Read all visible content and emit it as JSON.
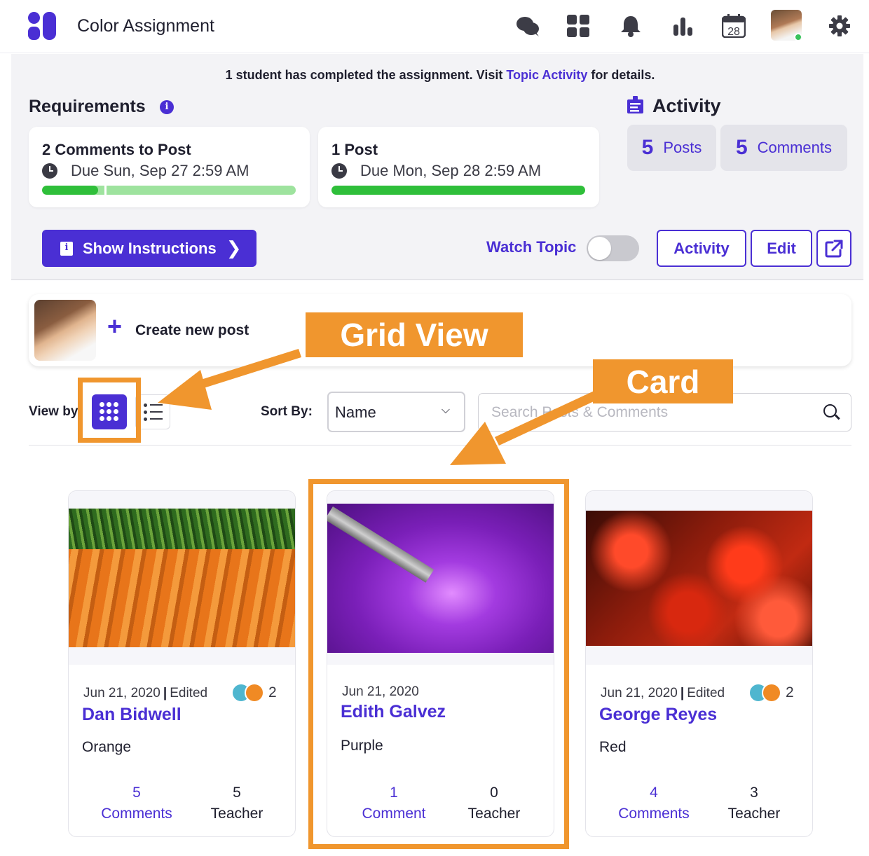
{
  "app": {
    "title": "Color Assignment"
  },
  "header_icons": [
    "chat-bubbles-icon",
    "apps-grid-icon",
    "bell-icon",
    "bar-chart-icon",
    "calendar-icon",
    "avatar",
    "gear-icon"
  ],
  "calendar_day": "28",
  "notice": {
    "before": "1 student has completed the assignment. Visit ",
    "link": "Topic Activity",
    "after": " for details."
  },
  "requirements": {
    "title": "Requirements",
    "info_glyph": "i",
    "items": [
      {
        "title": "2 Comments to Post",
        "due": "Due Sun, Sep 27 2:59 AM",
        "progress": 0.22
      },
      {
        "title": "1 Post",
        "due": "Due Mon, Sep 28 2:59 AM",
        "progress": 1.0
      }
    ]
  },
  "activity": {
    "title": "Activity",
    "posts_count": "5",
    "posts_label": "Posts",
    "comments_count": "5",
    "comments_label": "Comments"
  },
  "actions": {
    "show_instructions": "Show Instructions",
    "watch_topic": "Watch Topic",
    "watch_on": false,
    "activity": "Activity",
    "edit": "Edit"
  },
  "create_post": {
    "label": "Create new post"
  },
  "toolbar": {
    "view_by": "View by",
    "sort_by": "Sort By:",
    "sort_value": "Name",
    "search_placeholder": "Search Posts & Comments"
  },
  "annotations": {
    "grid_view": "Grid View",
    "card": "Card"
  },
  "posts": [
    {
      "date": "Jun 21, 2020",
      "edited": "Edited",
      "reactions": "2",
      "author": "Dan Bidwell",
      "text": "Orange",
      "comments_count": "5",
      "comments_label": "Comments",
      "teacher_count": "5",
      "teacher_label": "Teacher",
      "image": "carrots"
    },
    {
      "date": "Jun 21, 2020",
      "edited": "",
      "reactions": "",
      "author": "Edith Galvez",
      "text": "Purple",
      "comments_count": "1",
      "comments_label": "Comment",
      "teacher_count": "0",
      "teacher_label": "Teacher",
      "image": "purple-paint"
    },
    {
      "date": "Jun 21, 2020",
      "edited": "Edited",
      "reactions": "2",
      "author": "George Reyes",
      "text": "Red",
      "comments_count": "4",
      "comments_label": "Comments",
      "teacher_count": "3",
      "teacher_label": "Teacher",
      "image": "red-tree"
    }
  ],
  "colors": {
    "accent": "#4a2fd4",
    "annotation": "#f0962e",
    "progress": "#2fbf3a",
    "progress_track": "#9ee39e"
  }
}
